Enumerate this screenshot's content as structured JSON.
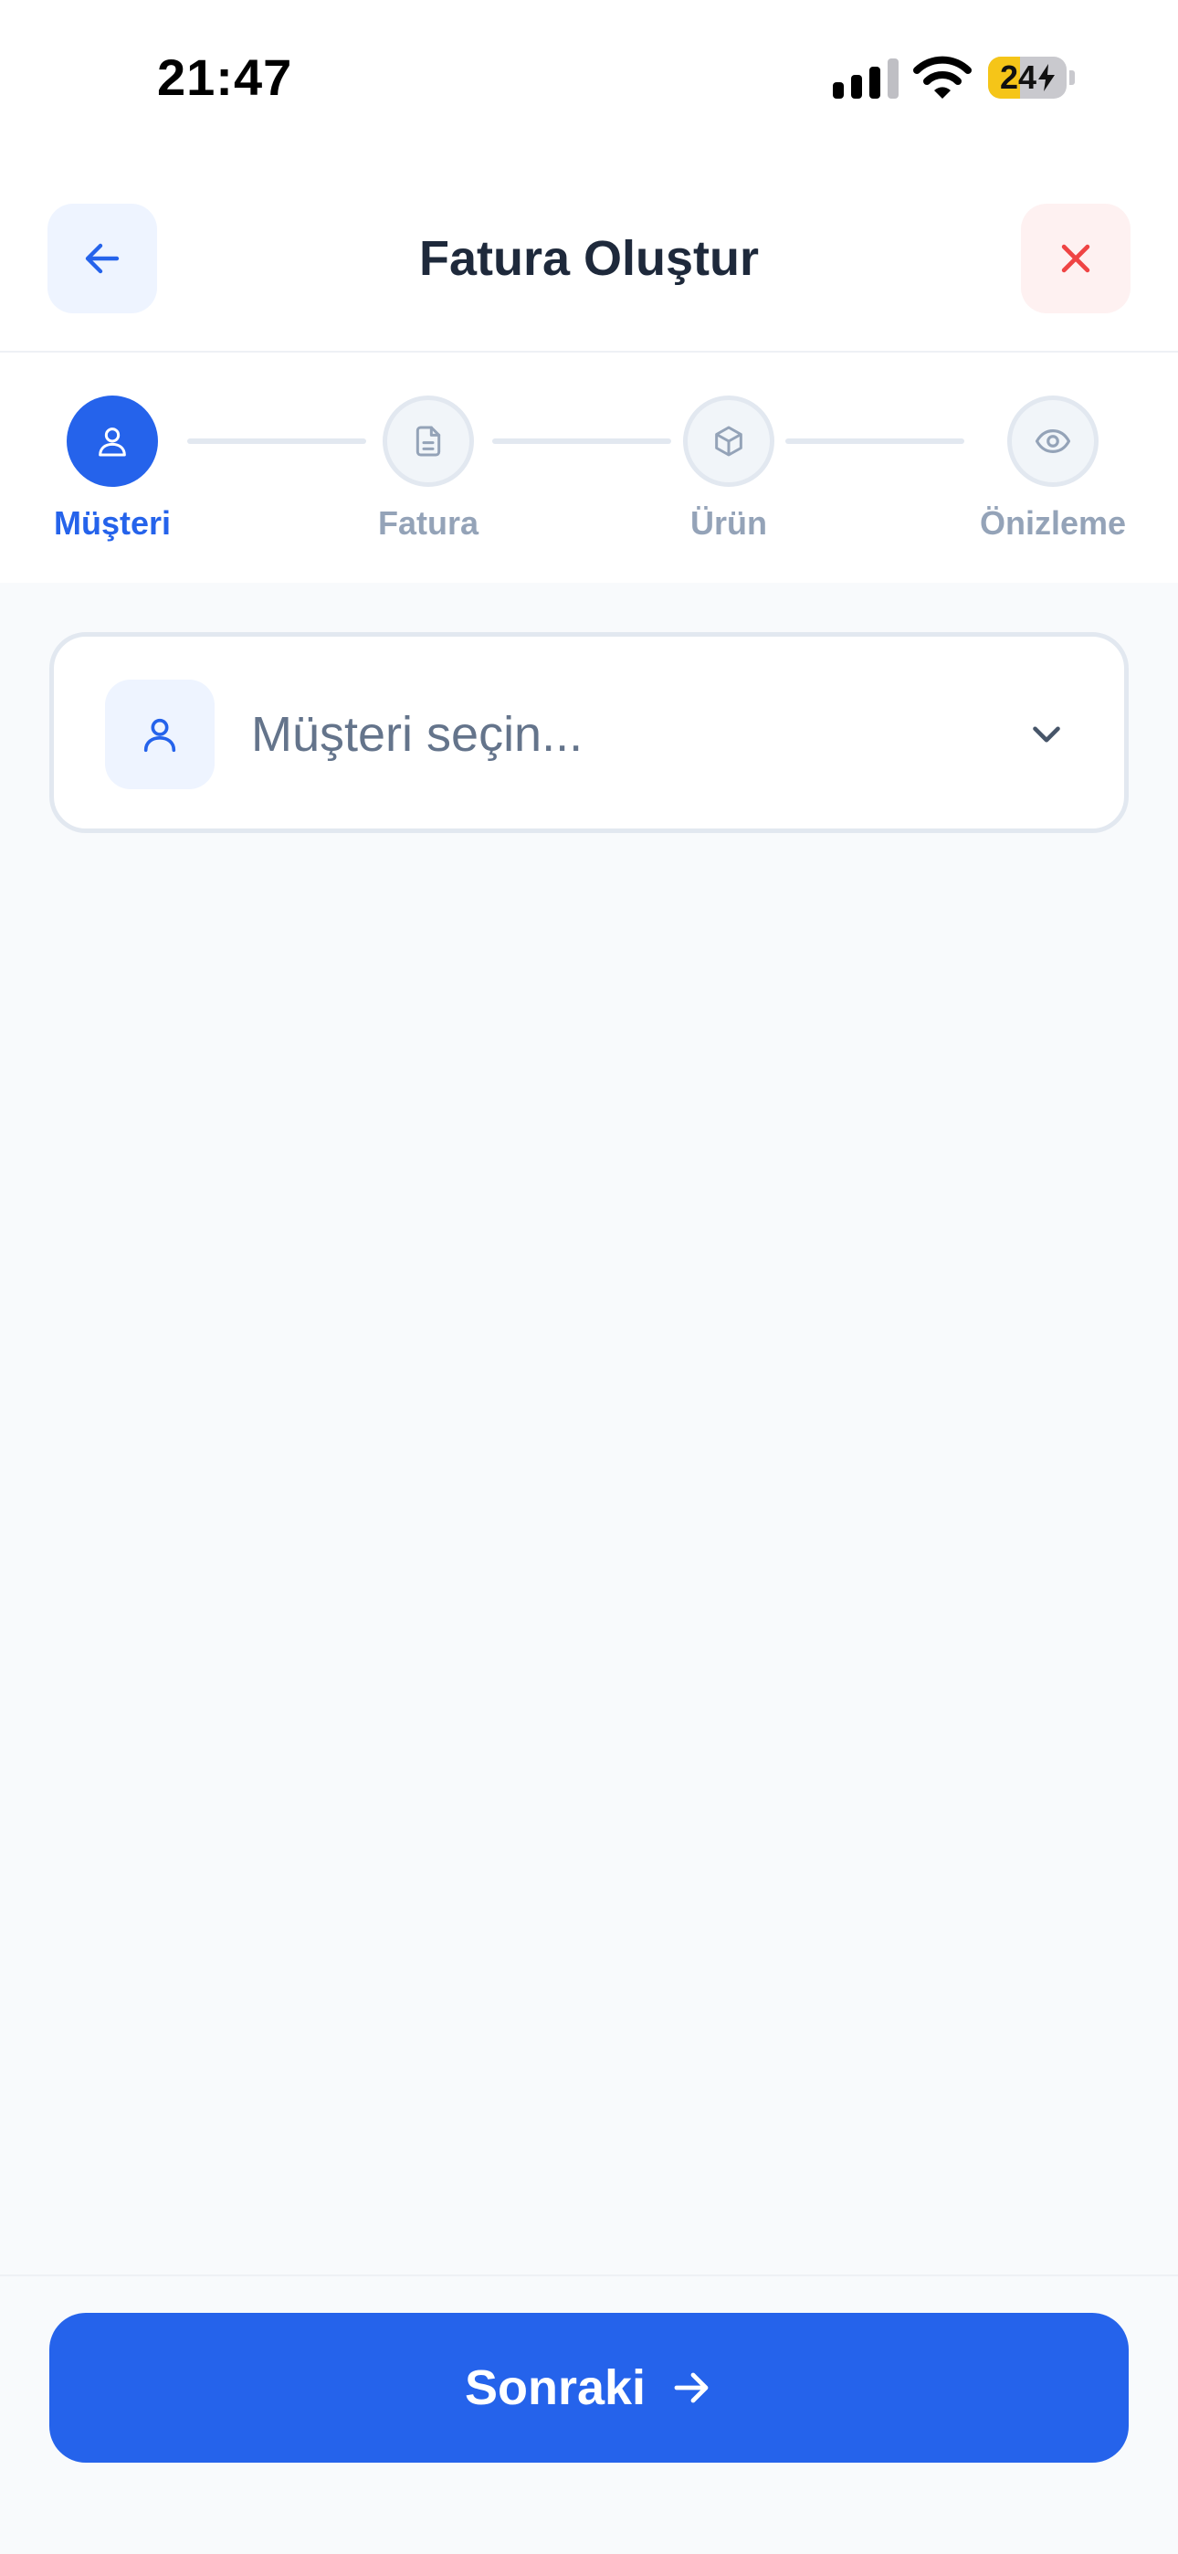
{
  "status_bar": {
    "time": "21:47",
    "battery": {
      "level_text": "24",
      "level_percent": 24,
      "charging": true,
      "icon": "bolt-icon"
    },
    "signal_icon": "cellular-signal-icon",
    "wifi_icon": "wifi-icon"
  },
  "header": {
    "title": "Fatura Oluştur",
    "back_icon": "arrow-left-icon",
    "close_icon": "close-icon"
  },
  "stepper": {
    "steps": [
      {
        "label": "Müşteri",
        "icon": "user-icon",
        "active": true
      },
      {
        "label": "Fatura",
        "icon": "document-icon",
        "active": false
      },
      {
        "label": "Ürün",
        "icon": "box-icon",
        "active": false
      },
      {
        "label": "Önizleme",
        "icon": "eye-icon",
        "active": false
      }
    ]
  },
  "customer_select": {
    "placeholder": "Müşteri seçin...",
    "icon": "user-icon",
    "chevron_icon": "chevron-down-icon"
  },
  "footer": {
    "next_label": "Sonraki",
    "next_icon": "arrow-right-icon"
  },
  "colors": {
    "primary": "#2563EB",
    "danger": "#EF4444",
    "muted": "#94A3B8",
    "background": "#F8FAFC"
  }
}
